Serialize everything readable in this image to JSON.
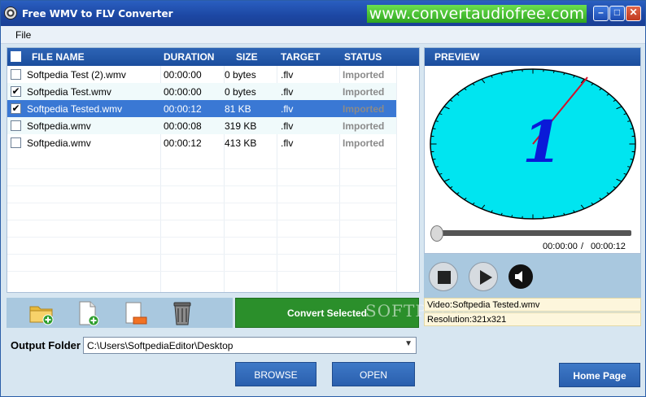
{
  "window": {
    "title": "Free WMV to FLV Converter",
    "banner": "www.convertaudiofree.com",
    "min_glyph": "–",
    "max_glyph": "□",
    "close_glyph": "✕"
  },
  "menu": {
    "file": "File"
  },
  "table": {
    "headers": [
      "FILE NAME",
      "DURATION",
      "SIZE",
      "TARGET",
      "STATUS"
    ],
    "rows": [
      {
        "checked": false,
        "name": "Softpedia Test (2).wmv",
        "duration": "00:00:00",
        "size": "0 bytes",
        "target": ".flv",
        "status": "Imported"
      },
      {
        "checked": true,
        "name": "Softpedia Test.wmv",
        "duration": "00:00:00",
        "size": "0 bytes",
        "target": ".flv",
        "status": "Imported"
      },
      {
        "checked": true,
        "name": "Softpedia Tested.wmv",
        "duration": "00:00:12",
        "size": "81 KB",
        "target": ".flv",
        "status": "Imported"
      },
      {
        "checked": false,
        "name": "Softpedia.wmv",
        "duration": "00:00:08",
        "size": "319 KB",
        "target": ".flv",
        "status": "Imported"
      },
      {
        "checked": false,
        "name": "Softpedia.wmv",
        "duration": "00:00:12",
        "size": "413 KB",
        "target": ".flv",
        "status": "Imported"
      }
    ]
  },
  "toolbar": {
    "icons": [
      "add-folder-icon",
      "add-file-icon",
      "remove-file-icon",
      "trash-icon"
    ],
    "convert_label": "Convert Selected"
  },
  "output": {
    "label": "Output Folder",
    "value": "C:\\Users\\SoftpediaEditor\\Desktop"
  },
  "buttons": {
    "browse": "BROWSE",
    "open": "OPEN",
    "home": "Home Page"
  },
  "preview": {
    "title": "PREVIEW",
    "current_time": "00:00:00",
    "separator": "/",
    "total_time": "00:00:12",
    "seek_position": 0,
    "clock_digit": "1",
    "video_info": "Video:Softpedia Tested.wmv",
    "resolution_info": "Resolution:321x321"
  },
  "watermark": "SOFTPEDIA",
  "colors": {
    "accent": "#1b4d9d",
    "convert": "#2b8f2b",
    "clock_face": "#00e5f0",
    "selected_row": "#3a78d4"
  }
}
